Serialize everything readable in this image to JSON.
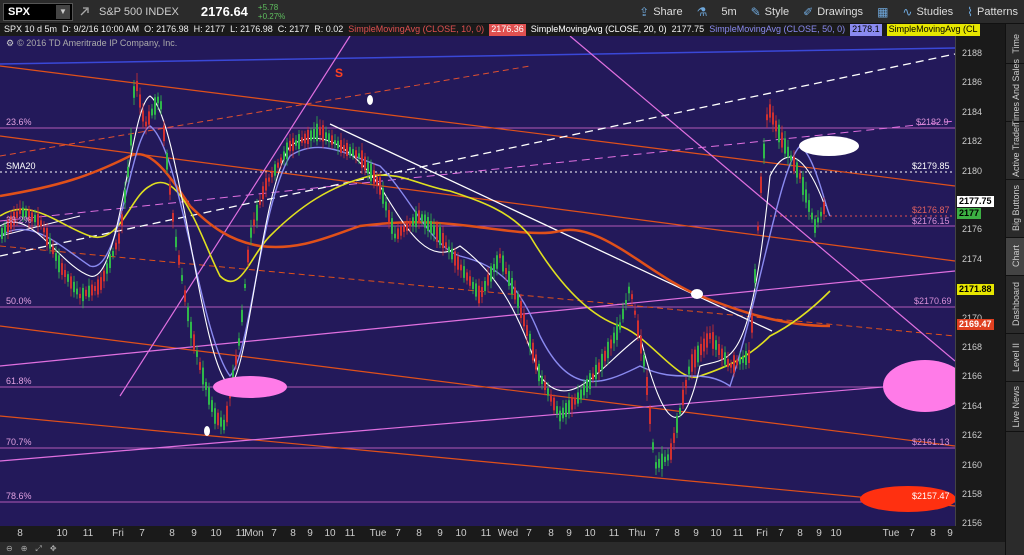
{
  "toolbar": {
    "symbol": "SPX",
    "symbol_arrow": "▼",
    "instrument_name": "S&P 500 INDEX",
    "last_price": "2176.64",
    "change": "+5.78",
    "change_pct": "+0.27%",
    "buttons": [
      {
        "label": "Share",
        "icon": "share-icon"
      },
      {
        "label": "",
        "icon": "flask-icon"
      },
      {
        "label": "5m",
        "icon": ""
      },
      {
        "label": "Style",
        "icon": "style-icon"
      },
      {
        "label": "Drawings",
        "icon": "drawings-icon"
      },
      {
        "label": "",
        "icon": "data-box-icon"
      },
      {
        "label": "Studies",
        "icon": "studies-icon"
      },
      {
        "label": "Patterns",
        "icon": "patterns-icon"
      }
    ]
  },
  "status": {
    "title": "SPX 10 d 5m",
    "timestamp": "D: 9/2/16 10:00 AM",
    "open": "O: 2176.98",
    "high": "H: 2177",
    "low": "L: 2176.98",
    "close": "C: 2177",
    "range": "R: 0.02",
    "sma10_label": "SimpleMovingAvg (CLOSE, 10, 0)",
    "sma10_value": "2176.36",
    "sma20_label": "SimpleMovingAvg (CLOSE, 20, 0)",
    "sma20_value": "2177.75",
    "sma50_label": "SimpleMovingAvg (CLOSE, 50, 0)",
    "sma50_value": "2178.1",
    "sma200_label": "SimpleMovingAvg (CL"
  },
  "copyright": "© 2016 TD Ameritrade IP Company, Inc.",
  "chart": {
    "fib_levels": [
      "23.6%",
      "38.2%",
      "50.0%",
      "61.8%",
      "70.7%",
      "78.6%"
    ],
    "price_labels": [
      "$2182.9",
      "$2179.85",
      "$2176.87",
      "$2176.15",
      "$2170.69",
      "$2161.13",
      "$2157.47"
    ],
    "sma_label": "SMA20",
    "annotation_s": "S"
  },
  "yaxis": {
    "ticks": [
      "2188",
      "2186",
      "2184",
      "2182",
      "2180",
      "2178",
      "2176",
      "2174",
      "2172",
      "2170",
      "2168",
      "2166",
      "2164",
      "2162",
      "2160",
      "2158",
      "2156"
    ],
    "flags": [
      {
        "value": "2177.75",
        "bg": "#ffffff",
        "fg": "#000000"
      },
      {
        "value": "2177",
        "bg": "#3cb043",
        "fg": "#000000"
      },
      {
        "value": "2171.88",
        "bg": "#e6e600",
        "fg": "#000000"
      },
      {
        "value": "2169.47",
        "bg": "#e04020",
        "fg": "#ffffff"
      }
    ]
  },
  "xaxis": {
    "ticks": [
      "8",
      "10",
      "11",
      "Fri",
      "7",
      "8",
      "9",
      "10",
      "11",
      "Mon",
      "7",
      "8",
      "9",
      "10",
      "11",
      "Tue",
      "7",
      "8",
      "9",
      "10",
      "11",
      "Wed",
      "7",
      "8",
      "9",
      "10",
      "11",
      "Thu",
      "7",
      "8",
      "9",
      "10",
      "11",
      "Fri",
      "7",
      "8",
      "9",
      "10",
      "Tue",
      "7",
      "8",
      "9"
    ]
  },
  "sidebar": {
    "tabs": [
      "Time",
      "Times And Sales",
      "Active Trader",
      "Big Buttons",
      "Chart",
      "Dashboard",
      "Level II",
      "Live News"
    ]
  },
  "colors": {
    "chart_bg": "#23195a",
    "sma10": "#e05050",
    "sma20": "#ffffff",
    "sma50": "#8a8af0",
    "sma200": "#e6e600",
    "fib_line": "#d070d0"
  }
}
